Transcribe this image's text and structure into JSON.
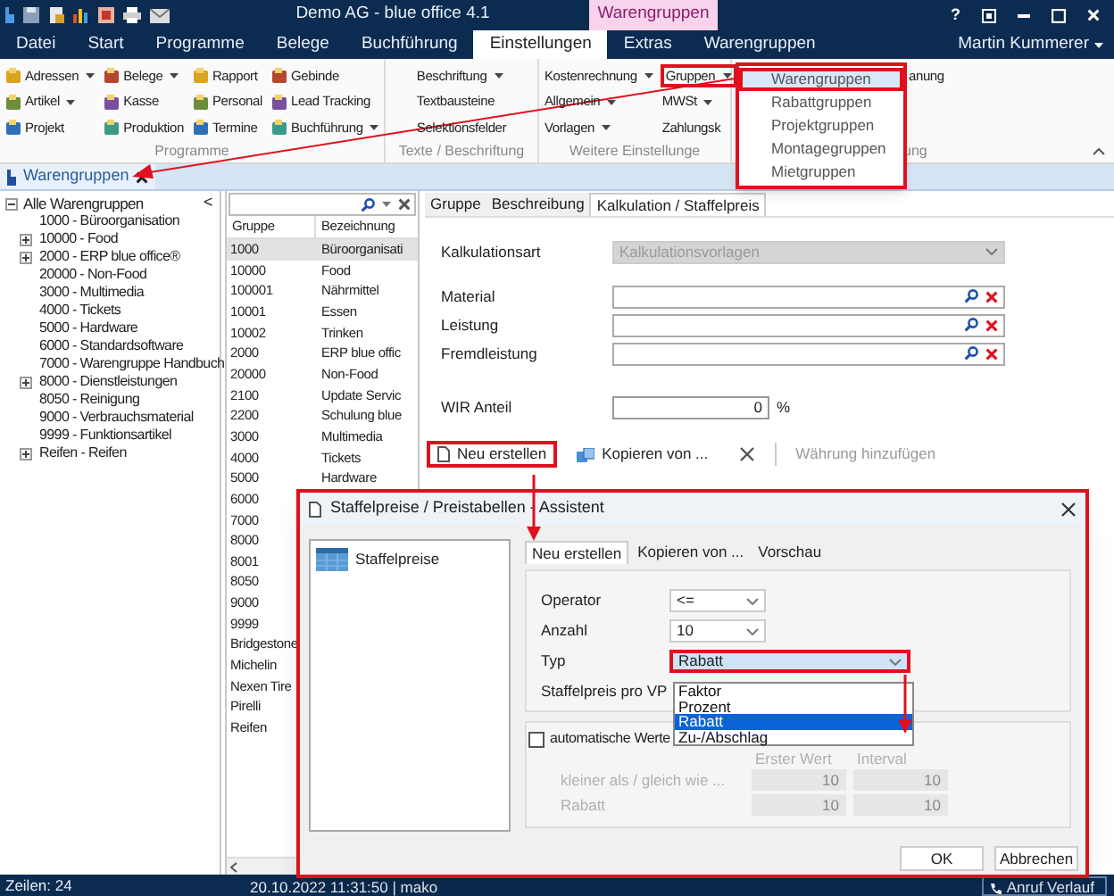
{
  "window": {
    "title": "Demo AG - blue office 4.1",
    "context_tab": "Warengruppen",
    "help": "?"
  },
  "menu_tabs": [
    {
      "label": "Datei",
      "selected": false
    },
    {
      "label": "Start",
      "selected": false
    },
    {
      "label": "Programme",
      "selected": false
    },
    {
      "label": "Belege",
      "selected": false
    },
    {
      "label": "Buchführung",
      "selected": false
    },
    {
      "label": "Einstellungen",
      "selected": true
    },
    {
      "label": "Extras",
      "selected": false
    },
    {
      "label": "Warengruppen",
      "selected": false
    }
  ],
  "user": "Martin Kummerer",
  "ribbon": {
    "groups": [
      {
        "label": "Programme",
        "kind": "icons",
        "columns": [
          [
            {
              "label": "Adressen",
              "dropdown": true,
              "highlighted": false
            },
            {
              "label": "Artikel",
              "dropdown": true,
              "highlighted": false
            },
            {
              "label": "Projekt",
              "dropdown": false,
              "highlighted": false
            }
          ],
          [
            {
              "label": "Belege",
              "dropdown": true,
              "highlighted": false
            },
            {
              "label": "Kasse",
              "dropdown": false,
              "highlighted": false
            },
            {
              "label": "Produktion",
              "dropdown": false,
              "highlighted": false
            }
          ],
          [
            {
              "label": "Rapport",
              "dropdown": false,
              "highlighted": false
            },
            {
              "label": "Personal",
              "dropdown": false,
              "highlighted": false
            },
            {
              "label": "Termine",
              "dropdown": false,
              "highlighted": false
            }
          ],
          [
            {
              "label": "Gebinde",
              "dropdown": false,
              "highlighted": false
            },
            {
              "label": "Lead Tracking",
              "dropdown": false,
              "highlighted": false
            },
            {
              "label": "Buchführung",
              "dropdown": true,
              "highlighted": false
            }
          ]
        ]
      },
      {
        "label": "Texte / Beschriftung",
        "kind": "text",
        "columns": [
          [
            {
              "label": "Beschriftung",
              "dropdown": true,
              "highlighted": false
            },
            {
              "label": "Textbausteine",
              "dropdown": false,
              "highlighted": false
            },
            {
              "label": "Selektionsfelder",
              "dropdown": false,
              "highlighted": false
            }
          ]
        ]
      },
      {
        "label": "Weitere Einstellunge",
        "kind": "text",
        "columns": [
          [
            {
              "label": "Kostenrechnung",
              "dropdown": true,
              "highlighted": false
            },
            {
              "label": "Allgemein",
              "dropdown": true,
              "highlighted": false
            },
            {
              "label": "Vorlagen",
              "dropdown": true,
              "highlighted": false
            }
          ],
          [
            {
              "label": "Gruppen",
              "dropdown": true,
              "highlighted": true
            },
            {
              "label": "MWSt",
              "dropdown": true,
              "highlighted": false
            },
            {
              "label": "Zahlungsk",
              "dropdown": false,
              "highlighted": false
            }
          ]
        ]
      },
      {
        "label": "ung",
        "kind": "text",
        "columns": [
          [
            {
              "label": "anung",
              "dropdown": false,
              "highlighted": false
            }
          ]
        ]
      }
    ]
  },
  "groups_menu": [
    {
      "label": "Warengruppen",
      "selected": true
    },
    {
      "label": "Rabattgruppen",
      "selected": false
    },
    {
      "label": "Projektgruppen",
      "selected": false
    },
    {
      "label": "Montagegruppen",
      "selected": false
    },
    {
      "label": "Mietgruppen",
      "selected": false
    }
  ],
  "document_tab": {
    "label": "Warengruppen"
  },
  "tree": {
    "label": "Alle Warengruppen",
    "expanded": true,
    "collapse_glyph": "<",
    "children": [
      {
        "label": "1000 - Büroorganisation",
        "kind": "leaf"
      },
      {
        "label": "10000 - Food",
        "kind": "folder"
      },
      {
        "label": "2000 - ERP blue office®",
        "kind": "folder"
      },
      {
        "label": "20000 - Non-Food",
        "kind": "leaf"
      },
      {
        "label": "3000 - Multimedia",
        "kind": "leaf"
      },
      {
        "label": "4000 - Tickets",
        "kind": "leaf"
      },
      {
        "label": "5000 - Hardware",
        "kind": "leaf"
      },
      {
        "label": "6000 - Standardsoftware",
        "kind": "leaf"
      },
      {
        "label": "7000 - Warengruppe Handbuch",
        "kind": "leaf"
      },
      {
        "label": "8000 - Dienstleistungen",
        "kind": "folder"
      },
      {
        "label": "8050 - Reinigung",
        "kind": "leaf"
      },
      {
        "label": "9000 - Verbrauchsmaterial",
        "kind": "leaf"
      },
      {
        "label": "9999 - Funktionsartikel",
        "kind": "leaf"
      },
      {
        "label": "Reifen - Reifen",
        "kind": "folder"
      }
    ]
  },
  "grid": {
    "columns": [
      "Gruppe",
      "Bezeichnung"
    ],
    "rows": [
      {
        "cells": [
          "1000",
          "Büroorganisati"
        ],
        "selected": true
      },
      {
        "cells": [
          "10000",
          "Food"
        ],
        "selected": false
      },
      {
        "cells": [
          "100001",
          "Nährmittel"
        ],
        "selected": false
      },
      {
        "cells": [
          "10001",
          "Essen"
        ],
        "selected": false
      },
      {
        "cells": [
          "10002",
          "Trinken"
        ],
        "selected": false
      },
      {
        "cells": [
          "2000",
          "ERP blue offic"
        ],
        "selected": false
      },
      {
        "cells": [
          "20000",
          "Non-Food"
        ],
        "selected": false
      },
      {
        "cells": [
          "2100",
          "Update Servic"
        ],
        "selected": false
      },
      {
        "cells": [
          "2200",
          "Schulung blue"
        ],
        "selected": false
      },
      {
        "cells": [
          "3000",
          "Multimedia"
        ],
        "selected": false
      },
      {
        "cells": [
          "4000",
          "Tickets"
        ],
        "selected": false
      },
      {
        "cells": [
          "5000",
          "Hardware"
        ],
        "selected": false
      },
      {
        "cells": [
          "6000"
        ],
        "selected": false
      },
      {
        "cells": [
          "7000"
        ],
        "selected": false
      },
      {
        "cells": [
          "8000"
        ],
        "selected": false
      },
      {
        "cells": [
          "8001"
        ],
        "selected": false
      },
      {
        "cells": [
          "8050"
        ],
        "selected": false
      },
      {
        "cells": [
          "9000"
        ],
        "selected": false
      },
      {
        "cells": [
          "9999"
        ],
        "selected": false
      },
      {
        "cells": [
          "Bridgestone"
        ],
        "selected": false
      },
      {
        "cells": [
          "Michelin"
        ],
        "selected": false
      },
      {
        "cells": [
          "Nexen Tire"
        ],
        "selected": false
      },
      {
        "cells": [
          "Pirelli"
        ],
        "selected": false
      },
      {
        "cells": [
          "Reifen"
        ],
        "selected": false
      }
    ]
  },
  "detail": {
    "tabs": [
      {
        "label": "Gruppe",
        "selected": false
      },
      {
        "label": "Beschreibung",
        "selected": false
      },
      {
        "label": "Kalkulation / Staffelpreis",
        "selected": true
      }
    ],
    "fields": [
      {
        "label": "Kalkulationsart",
        "kind": "select",
        "value": "Kalkulationsvorlagen",
        "disabled": true
      },
      {
        "label": "Material",
        "kind": "lookup",
        "disabled": false
      },
      {
        "label": "Leistung",
        "kind": "lookup",
        "disabled": false
      },
      {
        "label": "Fremdleistung",
        "kind": "lookup",
        "disabled": false
      },
      {
        "label": "WIR Anteil",
        "kind": "number",
        "value": "0",
        "unit": "%",
        "disabled": false
      }
    ],
    "toolbar": [
      {
        "label": "Neu erstellen",
        "kind": "new",
        "highlighted": true,
        "disabled": false
      },
      {
        "label": "Kopieren von ...",
        "kind": "copy",
        "highlighted": false,
        "disabled": false
      },
      {
        "kind": "delete",
        "highlighted": false,
        "disabled": false
      },
      {
        "label": "Währung hinzufügen",
        "kind": "plain",
        "highlighted": false,
        "disabled": true
      }
    ]
  },
  "dialog": {
    "title": "Staffelpreise / Preistabellen - Assistent",
    "highlighted": true,
    "nav": [
      {
        "label": "Staffelpreise"
      }
    ],
    "tabs": [
      {
        "label": "Neu erstellen",
        "selected": true
      },
      {
        "label": "Kopieren von ...",
        "selected": false
      },
      {
        "label": "Vorschau",
        "selected": false
      }
    ],
    "fields": [
      {
        "label": "Operator",
        "kind": "select",
        "value": "<=",
        "highlighted": false
      },
      {
        "label": "Anzahl",
        "kind": "select",
        "value": "10",
        "highlighted": false
      },
      {
        "label": "Typ",
        "kind": "select",
        "value": "Rabatt",
        "highlighted": true
      },
      {
        "label": "Staffelpreis pro VP",
        "kind": "covered"
      }
    ],
    "options": [
      {
        "label": "Faktor",
        "selected": false
      },
      {
        "label": "Prozent",
        "selected": false
      },
      {
        "label": "Rabatt",
        "selected": true
      },
      {
        "label": "Zu-/Abschlag",
        "selected": false
      }
    ],
    "auto_values": {
      "label": "automatische Werte",
      "checked": false
    },
    "table": {
      "disabled": true,
      "columns": [
        "Erster Wert",
        "Interval"
      ],
      "rows": [
        {
          "label": "kleiner als / gleich wie ...",
          "values": [
            "10",
            "10"
          ]
        },
        {
          "label": "Rabatt",
          "values": [
            "10",
            "10"
          ]
        }
      ]
    },
    "buttons": [
      "OK",
      "Abbrechen"
    ]
  },
  "status_bar": {
    "rows": "Zeilen: 24",
    "info": "20.10.2022 11:31:50 | mako",
    "call_history": "Anruf Verlauf"
  }
}
